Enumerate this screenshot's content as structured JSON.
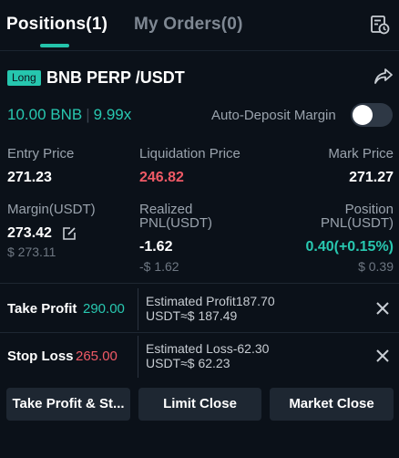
{
  "tabs": {
    "positions": "Positions(1)",
    "orders": "My Orders(0)"
  },
  "position": {
    "side": "Long",
    "symbol": "BNB PERP /USDT",
    "size": "10.00 BNB",
    "leverage": "9.99x",
    "auto_deposit_label": "Auto-Deposit Margin",
    "auto_deposit_on": false
  },
  "stats": {
    "entry_label": "Entry Price",
    "entry_value": "271.23",
    "liq_label": "Liquidation Price",
    "liq_value": "246.82",
    "mark_label": "Mark Price",
    "mark_value": "271.27",
    "margin_label": "Margin(USDT)",
    "margin_value": "273.42",
    "margin_sub": "$ 273.11",
    "realized_label_1": "Realized",
    "realized_label_2": "PNL(USDT)",
    "realized_value": "-1.62",
    "realized_sub": "-$ 1.62",
    "position_label_1": "Position",
    "position_label_2": "PNL(USDT)",
    "position_value": "0.40(+0.15%)",
    "position_sub": "$ 0.39"
  },
  "take_profit": {
    "label": "Take Profit",
    "price": "290.00",
    "est_line1": "Estimated Profit187.70",
    "est_line2": "USDT≈$ 187.49"
  },
  "stop_loss": {
    "label": "Stop Loss",
    "price": "265.00",
    "est_line1": "Estimated Loss-62.30",
    "est_line2": "USDT≈$ 62.23"
  },
  "buttons": {
    "tpsl": "Take Profit & St...",
    "limit_close": "Limit Close",
    "market_close": "Market Close"
  },
  "colors": {
    "accent": "#24c4ab",
    "loss": "#f05a66",
    "background": "#0b1119"
  }
}
